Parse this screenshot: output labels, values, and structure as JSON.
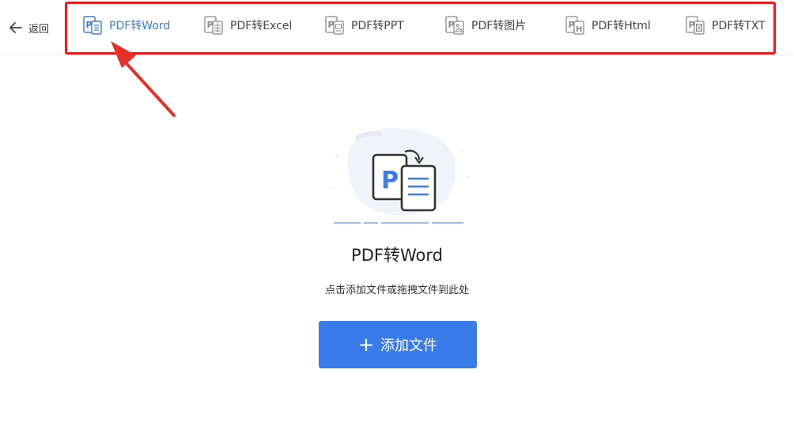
{
  "header": {
    "back_label": "返回",
    "tabs": [
      {
        "label": "PDF转Word",
        "icon": "pdf-word-icon",
        "active": true
      },
      {
        "label": "PDF转Excel",
        "icon": "pdf-excel-icon",
        "active": false
      },
      {
        "label": "PDF转PPT",
        "icon": "pdf-ppt-icon",
        "active": false
      },
      {
        "label": "PDF转图片",
        "icon": "pdf-image-icon",
        "active": false
      },
      {
        "label": "PDF转Html",
        "icon": "pdf-html-icon",
        "active": false
      },
      {
        "label": "PDF转TXT",
        "icon": "pdf-txt-icon",
        "active": false
      }
    ]
  },
  "main": {
    "illustration_icon": "pdf-to-word-illustration",
    "title": "PDF转Word",
    "hint": "点击添加文件或拖拽文件到此处",
    "add_button": {
      "icon": "plus-icon",
      "label": "添加文件"
    }
  },
  "colors": {
    "accent": "#3a7bea",
    "highlight_box": "#e02020",
    "annotation_arrow": "#e8302a"
  }
}
